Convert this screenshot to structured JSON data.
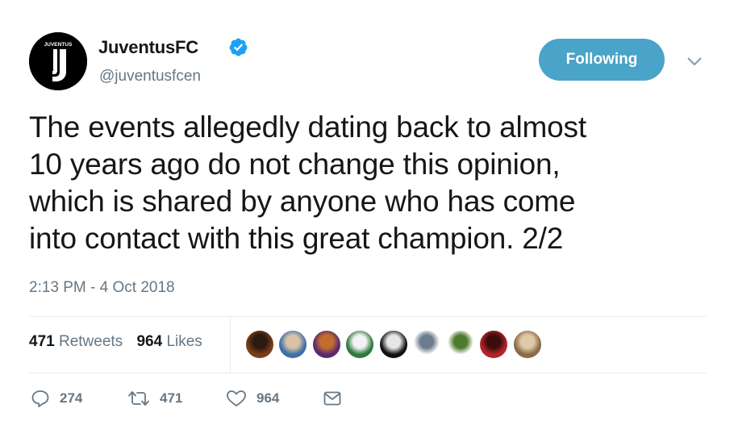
{
  "author": {
    "display_name": "JuventusFC",
    "handle": "@juventusfcen",
    "avatar_logo_text": "JUVENTUS",
    "verified": true
  },
  "follow_button": {
    "label": "Following",
    "color": "#4aa3c8"
  },
  "tweet": {
    "lines": [
      "The events allegedly dating back to almost",
      "10 years ago do not change this opinion,",
      "which is shared by anyone who has come",
      "into contact with this great champion. 2/2"
    ],
    "timestamp": "2:13 PM - 4 Oct 2018"
  },
  "stats": {
    "retweets": {
      "count": "471",
      "label": "Retweets"
    },
    "likes": {
      "count": "964",
      "label": "Likes"
    }
  },
  "liked_by_avatars": [
    {
      "name": "liker-avatar-1",
      "colors": [
        "#7a3d1a",
        "#2b1a10"
      ]
    },
    {
      "name": "liker-avatar-2",
      "colors": [
        "#3f6fa8",
        "#d9c2a5"
      ]
    },
    {
      "name": "liker-avatar-3",
      "colors": [
        "#5a2a6e",
        "#c26d2e"
      ]
    },
    {
      "name": "liker-avatar-4",
      "colors": [
        "#2e7a3e",
        "#f2f2f2"
      ]
    },
    {
      "name": "liker-avatar-5",
      "colors": [
        "#111111",
        "#e6e6e6"
      ]
    },
    {
      "name": "liker-avatar-6",
      "colors": [
        "#ffffff",
        "#6b7d8c"
      ]
    },
    {
      "name": "liker-avatar-7",
      "colors": [
        "#ffffff",
        "#4f7a2e"
      ]
    },
    {
      "name": "liker-avatar-8",
      "colors": [
        "#b3242a",
        "#3a0d0d"
      ]
    },
    {
      "name": "liker-avatar-9",
      "colors": [
        "#8a6a4a",
        "#e0c9a8"
      ]
    }
  ],
  "actions": {
    "reply": {
      "icon": "reply-icon",
      "count": "274"
    },
    "retweet": {
      "icon": "retweet-icon",
      "count": "471"
    },
    "like": {
      "icon": "heart-icon",
      "count": "964"
    },
    "message": {
      "icon": "envelope-icon"
    }
  },
  "colors": {
    "text": "#14171a",
    "secondary": "#657786",
    "accent": "#1da1f2",
    "divider": "#e6ecf0"
  }
}
